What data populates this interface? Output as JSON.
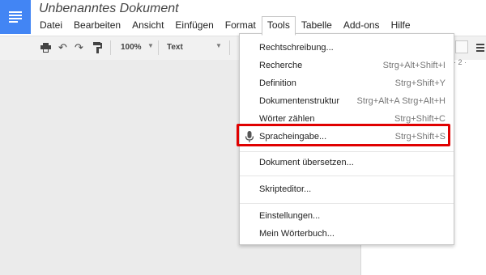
{
  "document": {
    "title": "Unbenanntes Dokument"
  },
  "menubar": {
    "items": [
      "Datei",
      "Bearbeiten",
      "Ansicht",
      "Einfügen",
      "Format",
      "Tools",
      "Tabelle",
      "Add-ons",
      "Hilfe"
    ],
    "active": "Tools"
  },
  "toolbar": {
    "icons": [
      "print-icon",
      "undo-icon",
      "redo-icon",
      "paint-format-icon"
    ],
    "zoom": "100%",
    "style": "Text"
  },
  "ruler": {
    "mark": "2"
  },
  "tools_menu": {
    "items": [
      {
        "label": "Rechtschreibung...",
        "shortcut": ""
      },
      {
        "label": "Recherche",
        "shortcut": "Strg+Alt+Shift+I"
      },
      {
        "label": "Definition",
        "shortcut": "Strg+Shift+Y"
      },
      {
        "label": "Dokumentenstruktur",
        "shortcut": "Strg+Alt+A Strg+Alt+H"
      },
      {
        "label": "Wörter zählen",
        "shortcut": "Strg+Shift+C"
      },
      {
        "label": "Spracheingabe...",
        "shortcut": "Strg+Shift+S",
        "icon": "microphone-icon",
        "highlighted": true
      },
      {
        "label": "Dokument übersetzen...",
        "shortcut": ""
      },
      {
        "label": "Skripteditor...",
        "shortcut": ""
      },
      {
        "label": "Einstellungen...",
        "shortcut": ""
      },
      {
        "label": "Mein Wörterbuch...",
        "shortcut": ""
      }
    ]
  },
  "colors": {
    "brand": "#4285f4",
    "highlight": "#e00000"
  }
}
